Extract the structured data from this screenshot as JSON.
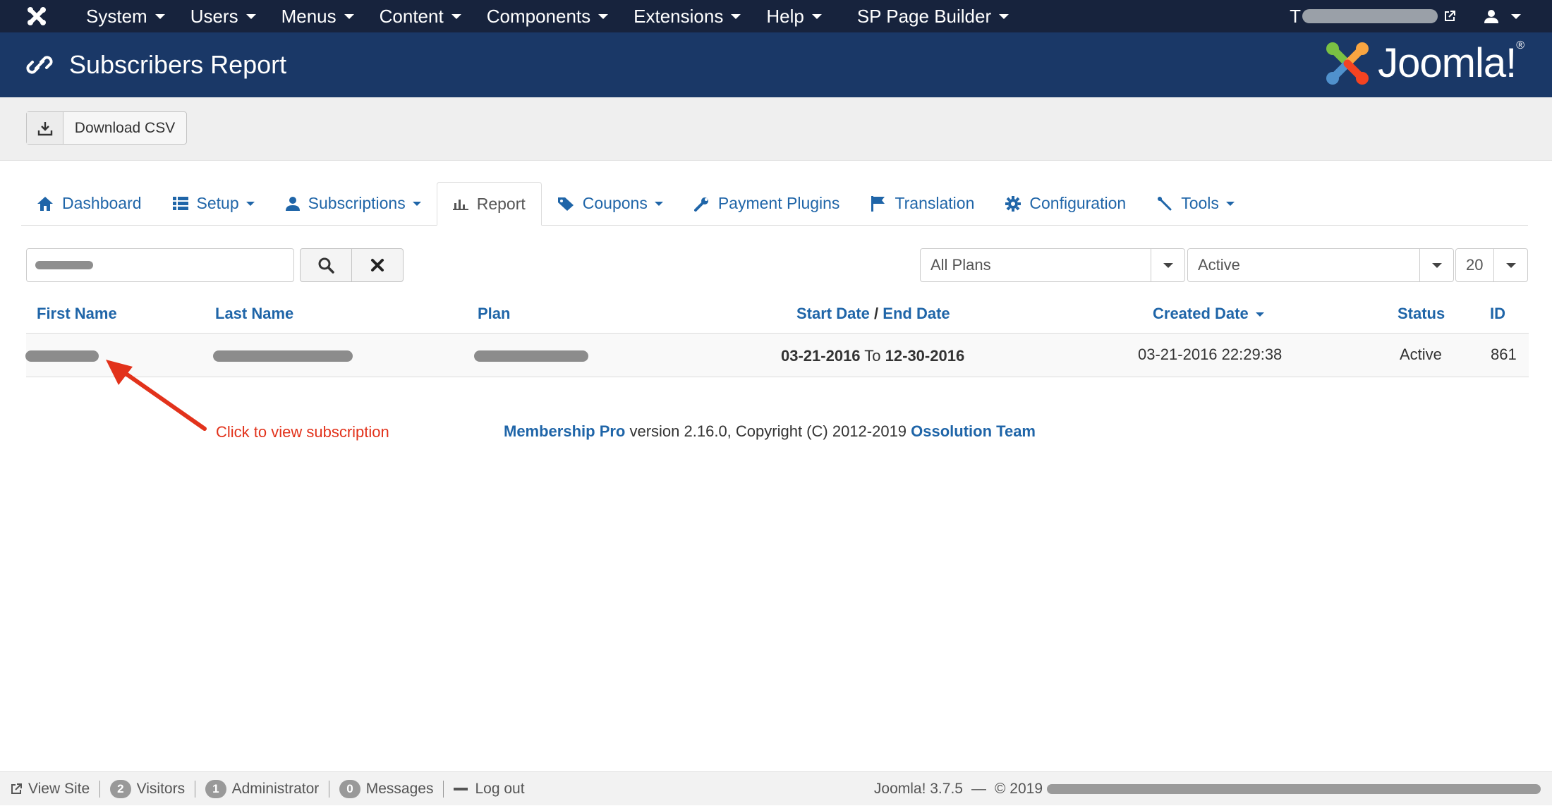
{
  "topbar": {
    "menus": [
      "System",
      "Users",
      "Menus",
      "Content",
      "Components",
      "Extensions",
      "Help",
      "SP Page Builder"
    ],
    "site_link_prefix": "T"
  },
  "header": {
    "title": "Subscribers Report",
    "brand": "Joomla!",
    "brand_mark": "®"
  },
  "toolbar": {
    "download_label": "Download CSV"
  },
  "tabs": [
    {
      "label": "Dashboard",
      "icon": "home-icon"
    },
    {
      "label": "Setup",
      "icon": "list-icon"
    },
    {
      "label": "Subscriptions",
      "icon": "user-icon"
    },
    {
      "label": "Report",
      "icon": "bar-chart-icon"
    },
    {
      "label": "Coupons",
      "icon": "tag-icon"
    },
    {
      "label": "Payment Plugins",
      "icon": "wrench-icon"
    },
    {
      "label": "Translation",
      "icon": "flag-icon"
    },
    {
      "label": "Configuration",
      "icon": "gear-icon"
    },
    {
      "label": "Tools",
      "icon": "tools-icon"
    }
  ],
  "filters": {
    "plan": "All Plans",
    "status": "Active",
    "limit": "20"
  },
  "table": {
    "headers": {
      "first_name": "First Name",
      "last_name": "Last Name",
      "plan": "Plan",
      "start_date": "Start Date",
      "slash": "/",
      "end_date": "End Date",
      "created_date": "Created Date",
      "status": "Status",
      "id": "ID"
    },
    "rows": [
      {
        "start": "03-21-2016",
        "to": "To",
        "end": "12-30-2016",
        "created": "03-21-2016 22:29:38",
        "status": "Active",
        "id": "861"
      }
    ]
  },
  "annotation": {
    "text": "Click to view subscription",
    "color": "#e2321b"
  },
  "footer": {
    "product": "Membership Pro",
    "version_text": " version 2.16.0, Copyright (C) 2012-2019 ",
    "team": "Ossolution Team"
  },
  "statusbar": {
    "view_site": "View Site",
    "visitors_count": "2",
    "visitors_label": "Visitors",
    "admin_count": "1",
    "admin_label": "Administrator",
    "messages_count": "0",
    "messages_label": "Messages",
    "logout": "Log out",
    "version": "Joomla! 3.7.5",
    "dash": "—",
    "copyright": "© 2019"
  },
  "colors": {
    "navbar": "#17233d",
    "header": "#1a3867",
    "link": "#1f65a8",
    "annotation": "#e2321b"
  }
}
